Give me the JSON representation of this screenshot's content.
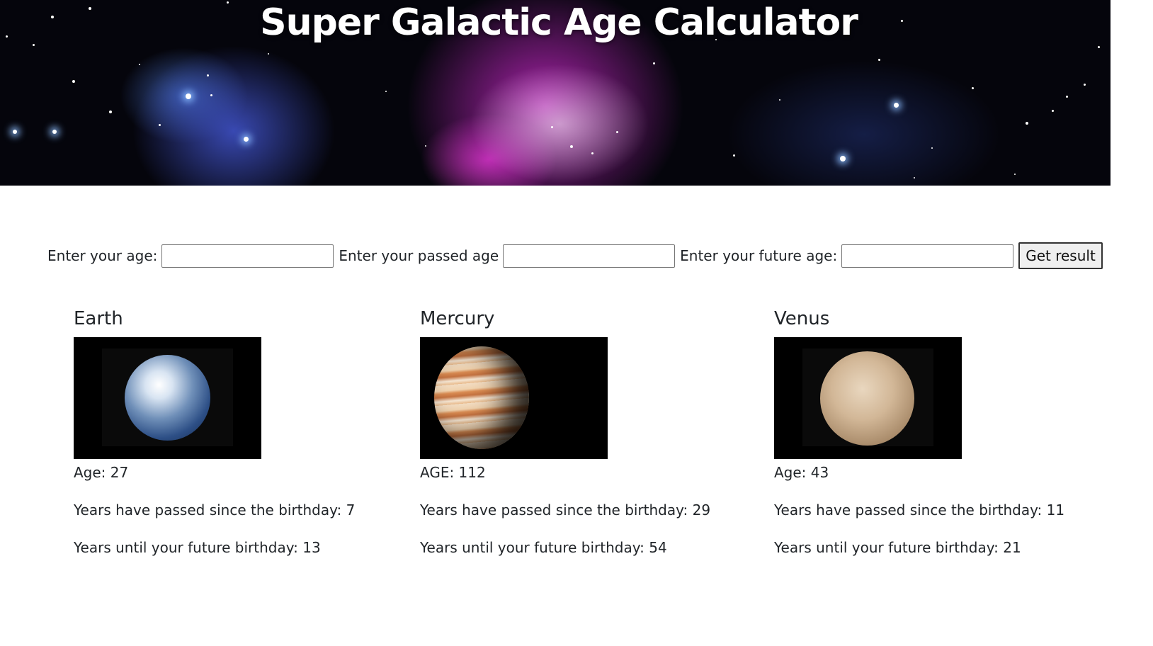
{
  "header": {
    "title": "Super Galactic Age Calculator"
  },
  "form": {
    "age_label": "Enter your age:",
    "age_value": "",
    "passed_label": "Enter your passed age",
    "passed_value": "",
    "future_label": "Enter your future age:",
    "future_value": "",
    "submit_label": "Get result"
  },
  "planets": [
    {
      "name": "Earth",
      "age": "Age: 27",
      "passed": "Years have passed since the birthday: 7",
      "future": "Years until your future birthday: 13",
      "image_icon": "earth-image"
    },
    {
      "name": "Mercury",
      "age": "AGE: 112",
      "passed": "Years have passed since the birthday: 29",
      "future": "Years until your future birthday: 54",
      "image_icon": "jupiter-like-image"
    },
    {
      "name": "Venus",
      "age": "Age: 43",
      "passed": "Years have passed since the birthday: 11",
      "future": "Years until your future birthday: 21",
      "image_icon": "mars-like-image"
    }
  ],
  "colors": {
    "text": "#212529",
    "hero_bg": "#05050c",
    "button_bg": "#efefef"
  }
}
